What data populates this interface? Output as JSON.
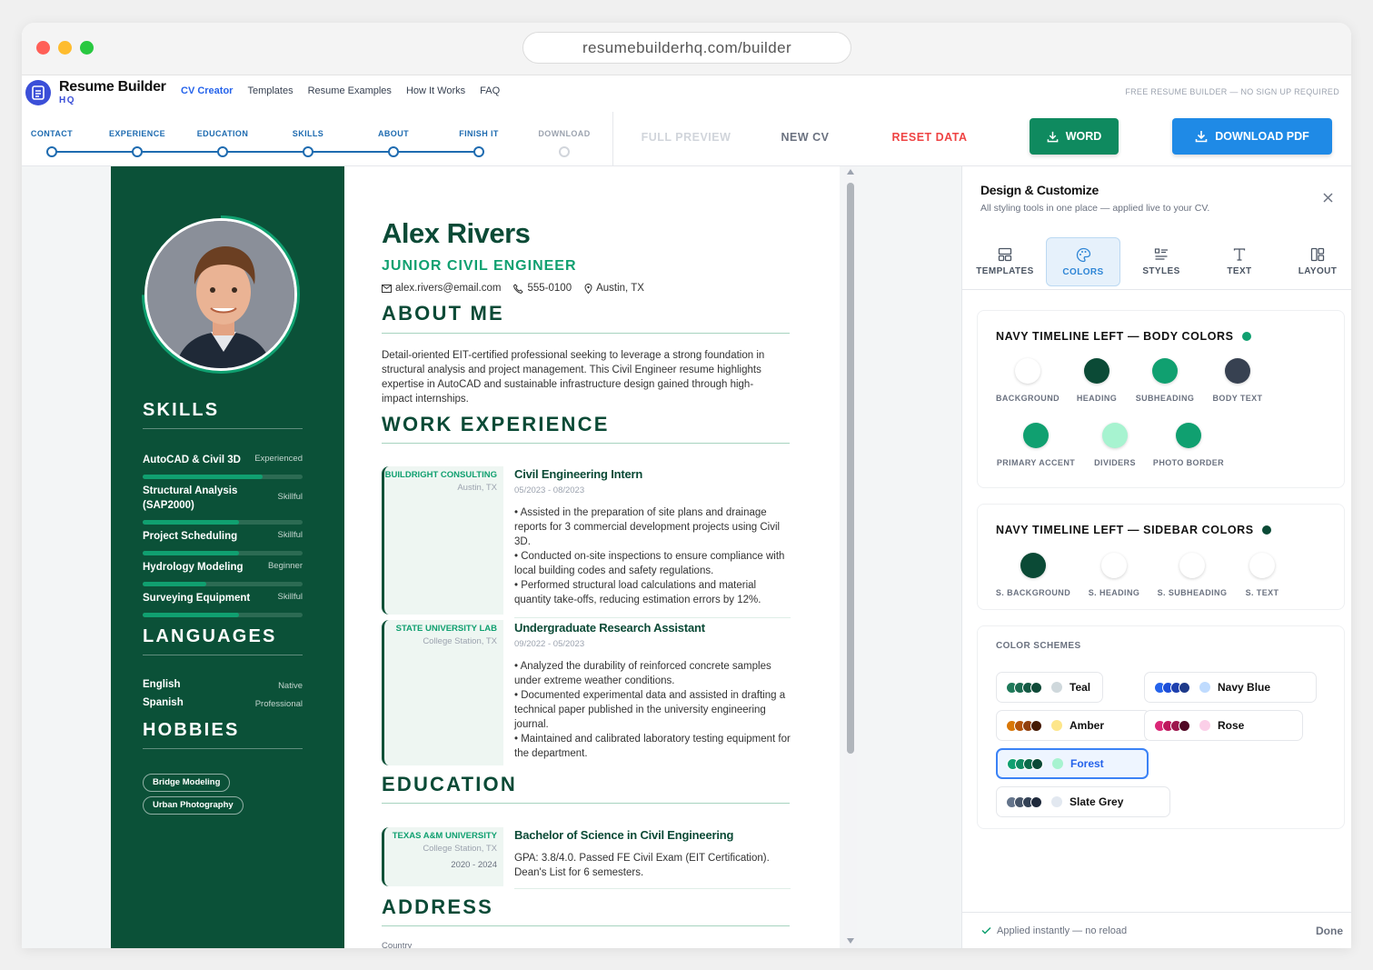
{
  "browser": {
    "url": "resumebuilderhq.com/builder"
  },
  "nav": {
    "brand": "Resume Builder",
    "brand_sub": "HQ",
    "links": [
      "CV Creator",
      "Templates",
      "Resume Examples",
      "How It Works",
      "FAQ"
    ],
    "tagline": "FREE RESUME BUILDER — NO SIGN UP REQUIRED"
  },
  "steps": [
    "CONTACT",
    "EXPERIENCE",
    "EDUCATION",
    "SKILLS",
    "ABOUT",
    "FINISH IT",
    "DOWNLOAD"
  ],
  "actions": {
    "full_preview": "FULL PREVIEW",
    "new_cv": "NEW CV",
    "reset": "RESET DATA",
    "word": "WORD",
    "pdf": "DOWNLOAD PDF"
  },
  "resume": {
    "name": "Alex Rivers",
    "title": "JUNIOR CIVIL ENGINEER",
    "email": "alex.rivers@email.com",
    "phone": "555-0100",
    "location": "Austin, TX",
    "sections": {
      "skills": "SKILLS",
      "languages": "LANGUAGES",
      "hobbies": "HOBBIES",
      "about": "ABOUT ME",
      "work": "WORK EXPERIENCE",
      "education": "EDUCATION",
      "address": "ADDRESS"
    },
    "about": "Detail-oriented EIT-certified professional seeking to leverage a strong foundation in structural analysis and project management. This Civil Engineer resume highlights expertise in AutoCAD and sustainable infrastructure design gained through high-impact internships.",
    "skills": [
      {
        "name": "AutoCAD & Civil 3D",
        "level": "Experienced",
        "fill": 0.75
      },
      {
        "name": "Structural Analysis (SAP2000)",
        "level": "Skillful",
        "fill": 0.6
      },
      {
        "name": "Project Scheduling",
        "level": "Skillful",
        "fill": 0.6
      },
      {
        "name": "Hydrology Modeling",
        "level": "Beginner",
        "fill": 0.4
      },
      {
        "name": "Surveying Equipment",
        "level": "Skillful",
        "fill": 0.6
      }
    ],
    "languages": [
      {
        "name": "English",
        "level": "Native"
      },
      {
        "name": "Spanish",
        "level": "Professional"
      }
    ],
    "hobbies": [
      "Bridge Modeling",
      "Urban Photography"
    ],
    "jobs": [
      {
        "company": "BUILDRIGHT CONSULTING",
        "location": "Austin, TX",
        "title": "Civil Engineering Intern",
        "dates": "05/2023 - 08/2023",
        "bullets": [
          "• Assisted in the preparation of site plans and drainage reports for 3 commercial development projects using Civil 3D.",
          "• Conducted on-site inspections to ensure compliance with local building codes and safety regulations.",
          "• Performed structural load calculations and material quantity take-offs, reducing estimation errors by 12%."
        ]
      },
      {
        "company": "STATE UNIVERSITY LAB",
        "location": "College Station, TX",
        "title": "Undergraduate Research Assistant",
        "dates": "09/2022 - 05/2023",
        "bullets": [
          "• Analyzed the durability of reinforced concrete samples under extreme weather conditions.",
          "• Documented experimental data and assisted in drafting a technical paper published in the university engineering journal.",
          "• Maintained and calibrated laboratory testing equipment for the department."
        ]
      }
    ],
    "education": {
      "school": "TEXAS A&M UNIVERSITY",
      "location": "College Station, TX",
      "dates": "2020 - 2024",
      "degree": "Bachelor of Science in Civil Engineering",
      "details": "GPA: 3.8/4.0. Passed FE Civil Exam (EIT Certification). Dean's List for 6 semesters."
    },
    "address_label": "Country"
  },
  "panel": {
    "title": "Design & Customize",
    "subtitle": "All styling tools in one place — applied live to your CV.",
    "tabs": [
      "TEMPLATES",
      "COLORS",
      "STYLES",
      "TEXT",
      "LAYOUT"
    ],
    "body_title": "NAVY TIMELINE LEFT — BODY COLORS",
    "body_status_color": "#10a070",
    "body_colors": [
      {
        "label": "BACKGROUND",
        "color": "#ffffff"
      },
      {
        "label": "HEADING",
        "color": "#0b4a36"
      },
      {
        "label": "SUBHEADING",
        "color": "#10a070"
      },
      {
        "label": "BODY TEXT",
        "color": "#374151"
      },
      {
        "label": "PRIMARY ACCENT",
        "color": "#10a070"
      },
      {
        "label": "DIVIDERS",
        "color": "#a7f3d0"
      },
      {
        "label": "PHOTO BORDER",
        "color": "#10a070"
      }
    ],
    "sidebar_title": "NAVY TIMELINE LEFT — SIDEBAR COLORS",
    "sidebar_status_color": "#0b4a36",
    "sidebar_colors": [
      {
        "label": "S. BACKGROUND",
        "color": "#0b4a36"
      },
      {
        "label": "S. HEADING",
        "color": "#ffffff"
      },
      {
        "label": "S. SUBHEADING",
        "color": "#ffffff"
      },
      {
        "label": "S. TEXT",
        "color": "#ffffff"
      }
    ],
    "schemes_title": "COLOR SCHEMES",
    "schemes": [
      {
        "name": "Teal",
        "dots": [
          "#1f7a5a",
          "#1b6b50",
          "#145a44",
          "#0f4a38"
        ],
        "swatch": "#cfd8dc",
        "active": false
      },
      {
        "name": "Navy Blue",
        "dots": [
          "#2563eb",
          "#1d4ed8",
          "#1e40af",
          "#1e3a8a"
        ],
        "swatch": "#bfdbfe",
        "active": false
      },
      {
        "name": "Amber",
        "dots": [
          "#d97706",
          "#b45309",
          "#92400e",
          "#451a03"
        ],
        "swatch": "#fde68a",
        "active": false
      },
      {
        "name": "Rose",
        "dots": [
          "#db2777",
          "#be185d",
          "#9d174d",
          "#500724"
        ],
        "swatch": "#fbcfe8",
        "active": false
      },
      {
        "name": "Forest",
        "dots": [
          "#10a070",
          "#0e8a60",
          "#0b6b4a",
          "#0b4a36"
        ],
        "swatch": "#a7f3d0",
        "active": true
      },
      {
        "name": "Slate Grey",
        "dots": [
          "#64748b",
          "#475569",
          "#334155",
          "#1e293b"
        ],
        "swatch": "#e2e8f0",
        "active": false
      }
    ],
    "footer_note": "Applied instantly — no reload",
    "done": "Done"
  }
}
